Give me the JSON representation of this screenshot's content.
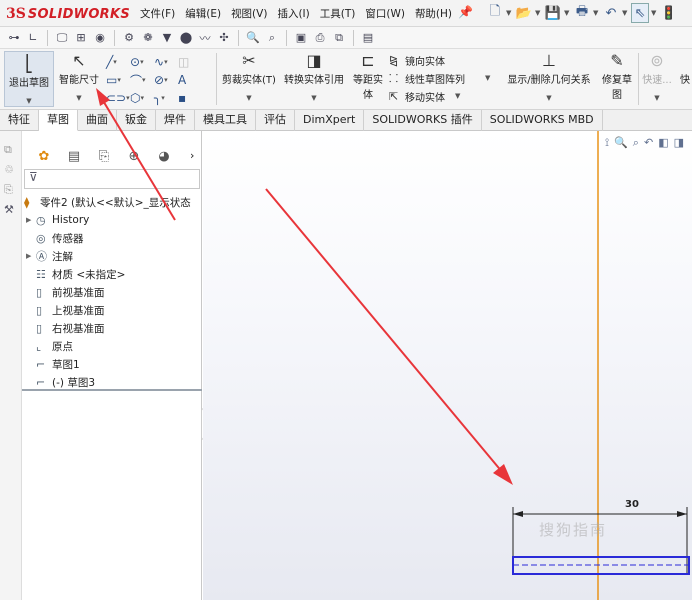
{
  "app": {
    "logo_prefix": "3S",
    "logo_name": "SOLIDWORKS"
  },
  "menu": [
    "文件(F)",
    "编辑(E)",
    "视图(V)",
    "插入(I)",
    "工具(T)",
    "窗口(W)",
    "帮助(H)"
  ],
  "ribbon": {
    "exit_sketch": "退出草图",
    "smart_dimension": "智能尺寸",
    "trim": "剪裁实体(T)",
    "convert": "转换实体引用",
    "offset_line1": "等距实",
    "offset_line2": "体",
    "mirror": "镜向实体",
    "linear_pattern": "线性草图阵列",
    "move": "移动实体",
    "relations": "显示/删除几何关系",
    "repair_line1": "修复草",
    "repair_line2": "图",
    "quick_snaps": "快速...",
    "quick_more": "快"
  },
  "tabs": [
    "特征",
    "草图",
    "曲面",
    "钣金",
    "焊件",
    "模具工具",
    "评估",
    "DimXpert",
    "SOLIDWORKS 插件",
    "SOLIDWORKS MBD"
  ],
  "tree": {
    "root": "零件2 (默认<<默认>_显示状态",
    "items": [
      {
        "label": "History",
        "icon": "history-icon",
        "expandable": true
      },
      {
        "label": "传感器",
        "icon": "sensor-icon",
        "expandable": false
      },
      {
        "label": "注解",
        "icon": "annotation-icon",
        "expandable": true
      },
      {
        "label": "材质 <未指定>",
        "icon": "material-icon",
        "expandable": false
      },
      {
        "label": "前视基准面",
        "icon": "plane-icon",
        "expandable": false
      },
      {
        "label": "上视基准面",
        "icon": "plane-icon",
        "expandable": false
      },
      {
        "label": "右视基准面",
        "icon": "plane-icon",
        "expandable": false
      },
      {
        "label": "原点",
        "icon": "origin-icon",
        "expandable": false
      },
      {
        "label": "草图1",
        "icon": "sketch-icon",
        "expandable": false
      },
      {
        "label": "(-) 草图3",
        "icon": "sketch-icon",
        "expandable": false
      }
    ]
  },
  "graphics": {
    "dimension_value": "30",
    "watermark": "搜狗指南"
  },
  "colors": {
    "annotation_arrow": "#e8353a",
    "construction_line": "#e8931a",
    "sketch_line": "#2a2ad8"
  }
}
